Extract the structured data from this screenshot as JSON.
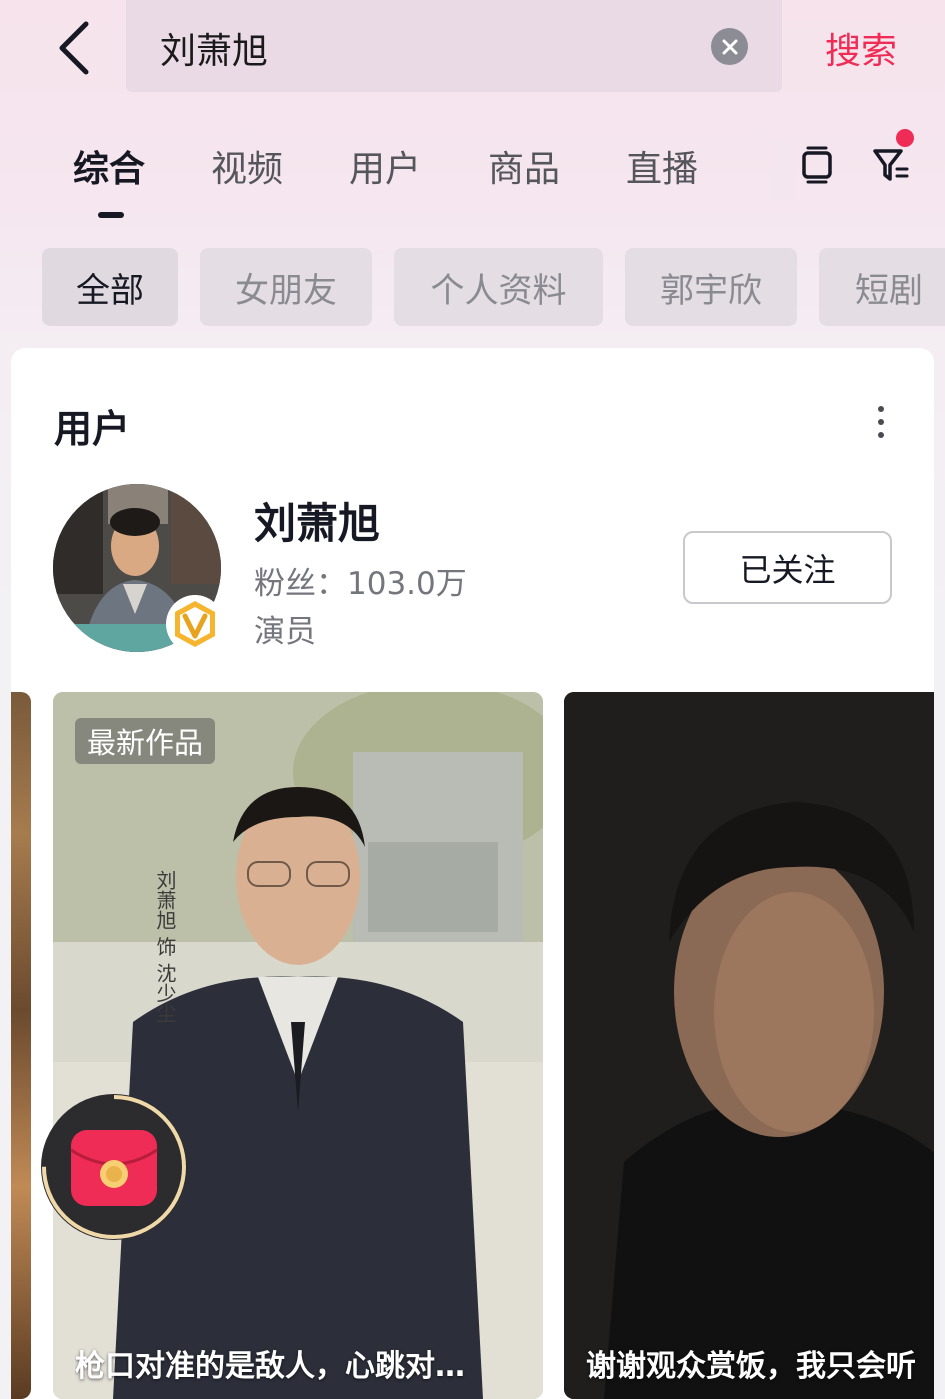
{
  "search": {
    "query": "刘萧旭",
    "submit_label": "搜索"
  },
  "tabs": [
    {
      "label": "综合",
      "active": true
    },
    {
      "label": "视频",
      "active": false
    },
    {
      "label": "用户",
      "active": false
    },
    {
      "label": "商品",
      "active": false
    },
    {
      "label": "直播",
      "active": false
    }
  ],
  "filter_chips": [
    {
      "label": "全部",
      "active": true
    },
    {
      "label": "女朋友",
      "active": false
    },
    {
      "label": "个人资料",
      "active": false
    },
    {
      "label": "郭宇欣",
      "active": false
    },
    {
      "label": "短剧",
      "active": false
    }
  ],
  "user_section": {
    "title": "用户",
    "user": {
      "name": "刘萧旭",
      "fans": "粉丝：103.0万",
      "role": "演员",
      "follow_label": "已关注"
    }
  },
  "videos": [
    {
      "badge": "最新作品",
      "overlay_text": "刘萧旭 饰 沈少尘",
      "caption": "枪口对准的是敌人，心跳对…"
    },
    {
      "caption": "谢谢观众赏饭，我只会听"
    }
  ],
  "colors": {
    "accent": "#ee2c55",
    "text_primary": "#161823",
    "text_secondary": "#75767d"
  },
  "icons": [
    "back-arrow-icon",
    "clear-icon",
    "list-icon",
    "filter-icon",
    "more-icon",
    "verified-v-icon",
    "red-packet-icon"
  ]
}
